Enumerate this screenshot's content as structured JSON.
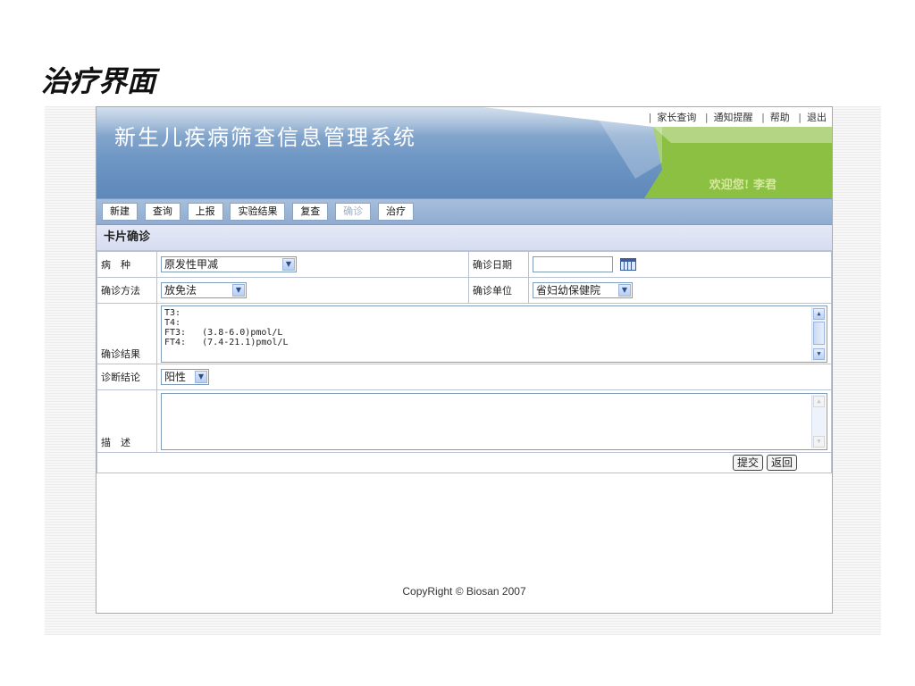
{
  "slide": {
    "title": "治疗界面"
  },
  "banner": {
    "title": "新生儿疾病筛查信息管理系统",
    "links": [
      "家长查询",
      "通知提醒",
      "帮助",
      "退出"
    ],
    "welcome": "欢迎您! 李君"
  },
  "nav": {
    "items": [
      {
        "label": "新建"
      },
      {
        "label": "查询"
      },
      {
        "label": "上报"
      },
      {
        "label": "实验结果"
      },
      {
        "label": "复查"
      },
      {
        "label": "确诊"
      },
      {
        "label": "治疗"
      }
    ]
  },
  "section": {
    "title": "卡片确诊"
  },
  "form": {
    "disease_label": "病　种",
    "disease_value": "原发性甲减",
    "confirm_date_label": "确诊日期",
    "confirm_date_value": "",
    "method_label": "确诊方法",
    "method_value": "放免法",
    "unit_label": "确诊单位",
    "unit_value": "省妇幼保健院",
    "result_label": "确诊结果",
    "result_lines": [
      "T3:",
      "T4:",
      "FT3:   (3.8-6.0)pmol/L",
      "FT4:   (7.4-21.1)pmol/L"
    ],
    "conclusion_label": "诊断结论",
    "conclusion_value": "阳性",
    "desc_label": "描　述",
    "desc_value": "",
    "submit_label": "提交",
    "back_label": "返回"
  },
  "footer": {
    "copyright": "CopyRight © Biosan 2007"
  },
  "colors": {
    "banner_blue": "#6f97c4",
    "banner_green": "#8cc043",
    "nav_blue": "#a7bfdc",
    "section_bg": "#dde3f4"
  }
}
